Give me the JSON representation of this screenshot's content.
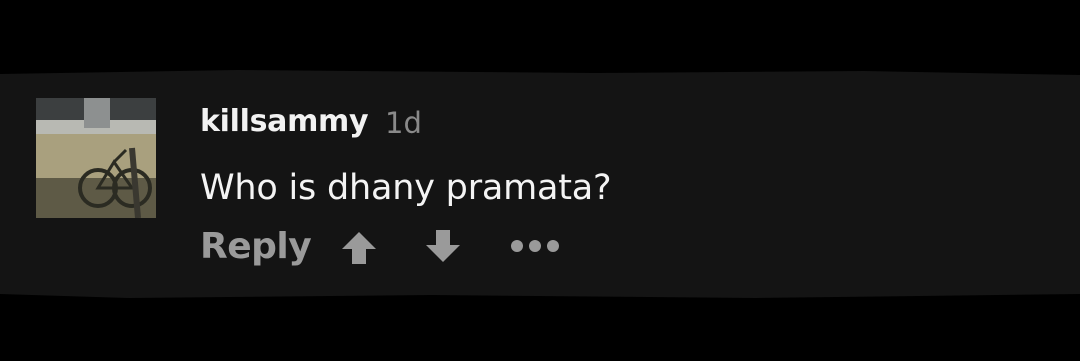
{
  "comment": {
    "username": "killsammy",
    "timestamp": "1d",
    "text": "Who is dhany pramata?",
    "avatar_icon": "bicycle-photo-avatar"
  },
  "actions": {
    "reply_label": "Reply",
    "upvote_icon": "arrow-up-icon",
    "downvote_icon": "arrow-down-icon",
    "more_icon": "more-dots-icon"
  },
  "colors": {
    "background": "#000000",
    "card": "#141414",
    "username": "#f2f2f2",
    "timestamp": "#8a8a8a",
    "body_text": "#f4f4f4",
    "action": "#9a9a9a"
  }
}
